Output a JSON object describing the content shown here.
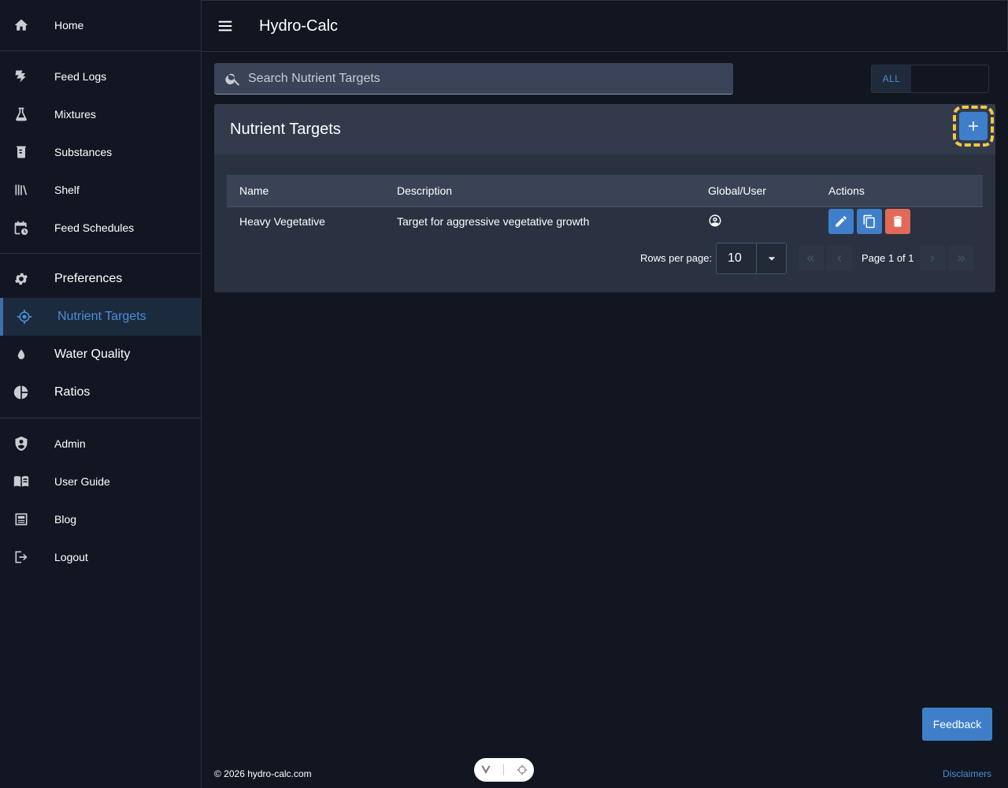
{
  "app": {
    "title": "Hydro-Calc"
  },
  "sidebar": {
    "group1": [
      {
        "label": "Home",
        "icon": "home-icon"
      }
    ],
    "group2": [
      {
        "label": "Feed Logs",
        "icon": "feed-logs-icon"
      },
      {
        "label": "Mixtures",
        "icon": "flask-icon"
      },
      {
        "label": "Substances",
        "icon": "container-icon"
      },
      {
        "label": "Shelf",
        "icon": "books-icon"
      },
      {
        "label": "Feed Schedules",
        "icon": "calendar-clock-icon"
      }
    ],
    "group3": [
      {
        "label": "Preferences",
        "icon": "gear-icon"
      },
      {
        "label": "Nutrient Targets",
        "icon": "crosshair-icon",
        "active": true
      },
      {
        "label": "Water Quality",
        "icon": "water-drop-icon"
      },
      {
        "label": "Ratios",
        "icon": "pie-chart-icon"
      }
    ],
    "group4": [
      {
        "label": "Admin",
        "icon": "shield-icon"
      },
      {
        "label": "User Guide",
        "icon": "book-icon"
      },
      {
        "label": "Blog",
        "icon": "article-icon"
      },
      {
        "label": "Logout",
        "icon": "logout-icon"
      }
    ]
  },
  "search": {
    "placeholder": "Search Nutrient Targets",
    "value": ""
  },
  "filter_toggle": {
    "label": "ALL"
  },
  "card": {
    "title": "Nutrient Targets",
    "columns": [
      "Name",
      "Description",
      "Global/User",
      "Actions"
    ],
    "rows": [
      {
        "name": "Heavy Vegetative",
        "description": "Target for aggressive vegetative growth",
        "scope_icon": "user-circle-icon"
      }
    ],
    "pagination": {
      "rows_per_page_label": "Rows per page:",
      "rows_per_page": "10",
      "page_label": "Page 1 of 1"
    }
  },
  "footer": {
    "feedback": "Feedback",
    "copyright": "© 2026 hydro-calc.com",
    "disclaimers": "Disclaimers"
  },
  "colors": {
    "accent": "#3f7fca",
    "danger": "#e06a57",
    "highlight": "#f5c842",
    "background": "#111621"
  }
}
